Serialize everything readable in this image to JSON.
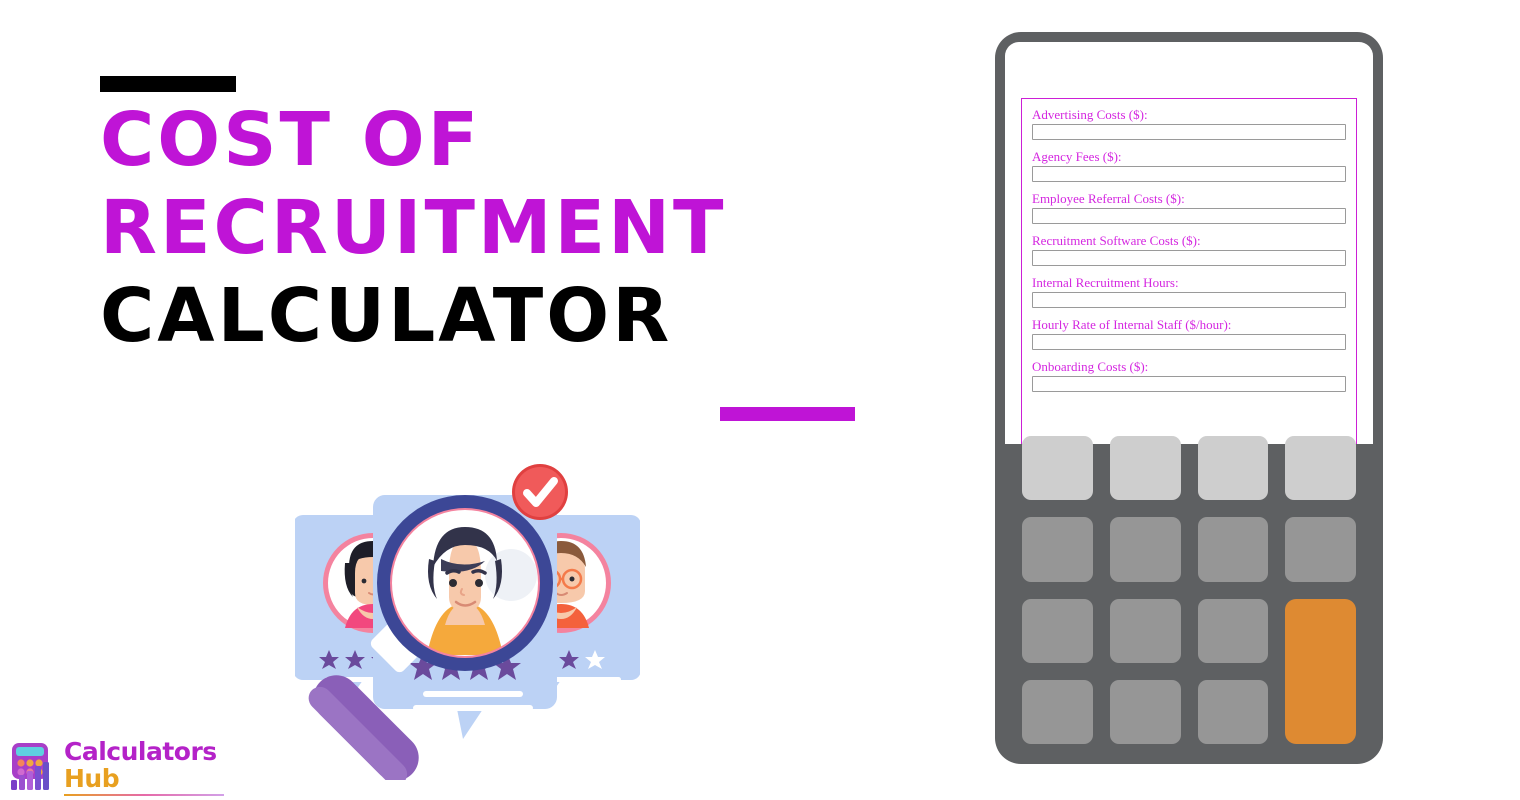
{
  "hero": {
    "title_lines": [
      {
        "text": "Cost of",
        "color": "#bf14d6"
      },
      {
        "text": "Recruitment",
        "color": "#bf14d6"
      },
      {
        "text": "Calculator",
        "color": "#000000"
      }
    ],
    "accent_bar_top_color": "#000000",
    "accent_bar_bottom_color": "#bf14d6"
  },
  "logo": {
    "word_primary": "Calculators",
    "word_secondary": "Hub",
    "primary_color": "#b422c8",
    "secondary_color": "#e8a020",
    "icon": "calculator-bar-chart-icon"
  },
  "illustration": {
    "name": "candidate-search-illustration",
    "cards": [
      {
        "position": "left",
        "avatar": "woman-black-bob-pink-top",
        "stars_filled": 3,
        "stars_total": 4
      },
      {
        "position": "center",
        "avatar": "man-dark-hair-yellow-top",
        "stars_filled": 4,
        "stars_total": 4
      },
      {
        "position": "right",
        "avatar": "woman-brown-hair-glasses-orange-top",
        "stars_filled": 3,
        "stars_total": 4
      }
    ],
    "badge": "check-circle-badge",
    "badge_color": "#f05a5a",
    "magnifier_color": "#3c4796",
    "magnifier_handle_color": "#8a5fb8",
    "card_color": "#bcd2f5"
  },
  "calculator": {
    "body_color": "#5e6062",
    "screen_color": "#ffffff",
    "form_border_color": "#cc1fd6",
    "label_color": "#d426e0",
    "fields": [
      {
        "label": "Advertising Costs ($):",
        "value": "",
        "placeholder": ""
      },
      {
        "label": "Agency Fees ($):",
        "value": "",
        "placeholder": ""
      },
      {
        "label": "Employee Referral Costs ($):",
        "value": "",
        "placeholder": ""
      },
      {
        "label": "Recruitment Software Costs ($):",
        "value": "",
        "placeholder": ""
      },
      {
        "label": "Internal Recruitment Hours:",
        "value": "",
        "placeholder": ""
      },
      {
        "label": "Hourly Rate of Internal Staff ($/hour):",
        "value": "",
        "placeholder": ""
      },
      {
        "label": "Onboarding Costs ($):",
        "value": "",
        "placeholder": ""
      }
    ],
    "keypad": {
      "light_key_color": "#cecece",
      "mid_key_color": "#969696",
      "accent_key_color": "#de8a32",
      "keys": [
        {
          "label": "",
          "style": "light"
        },
        {
          "label": "",
          "style": "light"
        },
        {
          "label": "",
          "style": "light"
        },
        {
          "label": "",
          "style": "light"
        },
        {
          "label": "",
          "style": "mid"
        },
        {
          "label": "",
          "style": "mid"
        },
        {
          "label": "",
          "style": "mid"
        },
        {
          "label": "",
          "style": "mid"
        },
        {
          "label": "",
          "style": "mid"
        },
        {
          "label": "",
          "style": "mid"
        },
        {
          "label": "",
          "style": "mid"
        },
        {
          "label": "",
          "style": "accent"
        },
        {
          "label": "",
          "style": "mid"
        },
        {
          "label": "",
          "style": "mid"
        },
        {
          "label": "",
          "style": "mid"
        }
      ]
    }
  }
}
